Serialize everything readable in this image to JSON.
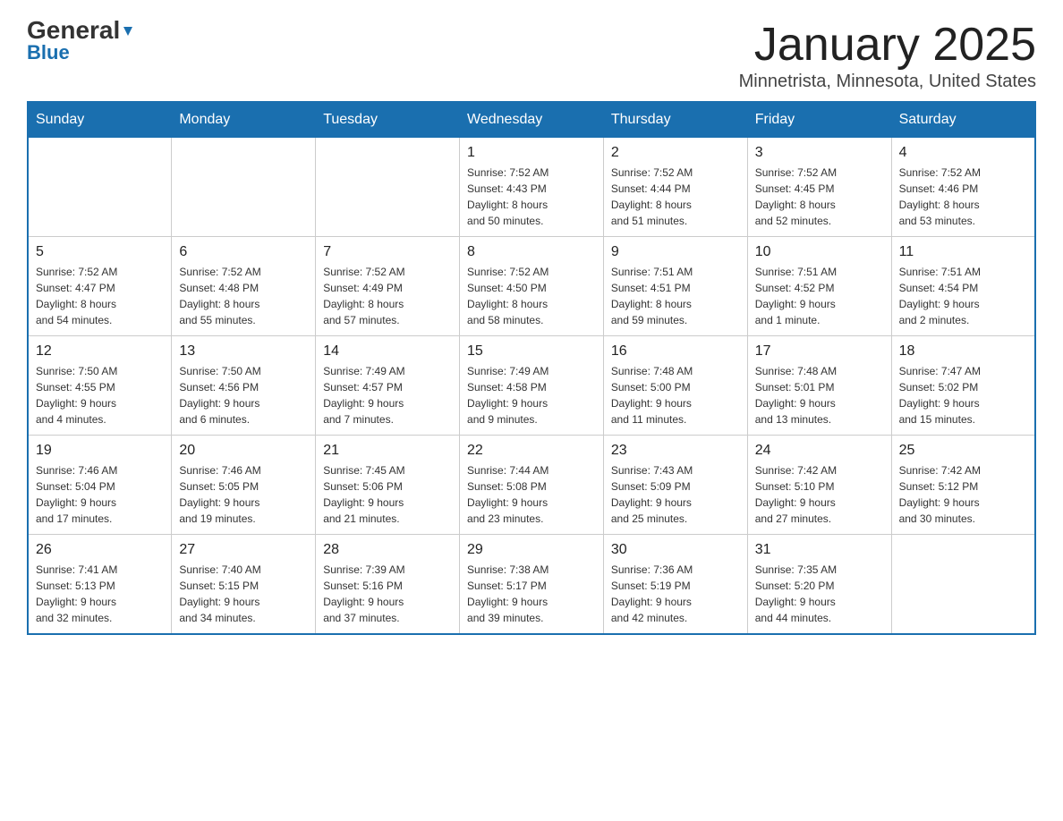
{
  "header": {
    "logo": {
      "general": "General",
      "blue": "Blue"
    },
    "title": "January 2025",
    "location": "Minnetrista, Minnesota, United States"
  },
  "weekdays": [
    "Sunday",
    "Monday",
    "Tuesday",
    "Wednesday",
    "Thursday",
    "Friday",
    "Saturday"
  ],
  "weeks": [
    [
      {
        "day": "",
        "info": ""
      },
      {
        "day": "",
        "info": ""
      },
      {
        "day": "",
        "info": ""
      },
      {
        "day": "1",
        "info": "Sunrise: 7:52 AM\nSunset: 4:43 PM\nDaylight: 8 hours\nand 50 minutes."
      },
      {
        "day": "2",
        "info": "Sunrise: 7:52 AM\nSunset: 4:44 PM\nDaylight: 8 hours\nand 51 minutes."
      },
      {
        "day": "3",
        "info": "Sunrise: 7:52 AM\nSunset: 4:45 PM\nDaylight: 8 hours\nand 52 minutes."
      },
      {
        "day": "4",
        "info": "Sunrise: 7:52 AM\nSunset: 4:46 PM\nDaylight: 8 hours\nand 53 minutes."
      }
    ],
    [
      {
        "day": "5",
        "info": "Sunrise: 7:52 AM\nSunset: 4:47 PM\nDaylight: 8 hours\nand 54 minutes."
      },
      {
        "day": "6",
        "info": "Sunrise: 7:52 AM\nSunset: 4:48 PM\nDaylight: 8 hours\nand 55 minutes."
      },
      {
        "day": "7",
        "info": "Sunrise: 7:52 AM\nSunset: 4:49 PM\nDaylight: 8 hours\nand 57 minutes."
      },
      {
        "day": "8",
        "info": "Sunrise: 7:52 AM\nSunset: 4:50 PM\nDaylight: 8 hours\nand 58 minutes."
      },
      {
        "day": "9",
        "info": "Sunrise: 7:51 AM\nSunset: 4:51 PM\nDaylight: 8 hours\nand 59 minutes."
      },
      {
        "day": "10",
        "info": "Sunrise: 7:51 AM\nSunset: 4:52 PM\nDaylight: 9 hours\nand 1 minute."
      },
      {
        "day": "11",
        "info": "Sunrise: 7:51 AM\nSunset: 4:54 PM\nDaylight: 9 hours\nand 2 minutes."
      }
    ],
    [
      {
        "day": "12",
        "info": "Sunrise: 7:50 AM\nSunset: 4:55 PM\nDaylight: 9 hours\nand 4 minutes."
      },
      {
        "day": "13",
        "info": "Sunrise: 7:50 AM\nSunset: 4:56 PM\nDaylight: 9 hours\nand 6 minutes."
      },
      {
        "day": "14",
        "info": "Sunrise: 7:49 AM\nSunset: 4:57 PM\nDaylight: 9 hours\nand 7 minutes."
      },
      {
        "day": "15",
        "info": "Sunrise: 7:49 AM\nSunset: 4:58 PM\nDaylight: 9 hours\nand 9 minutes."
      },
      {
        "day": "16",
        "info": "Sunrise: 7:48 AM\nSunset: 5:00 PM\nDaylight: 9 hours\nand 11 minutes."
      },
      {
        "day": "17",
        "info": "Sunrise: 7:48 AM\nSunset: 5:01 PM\nDaylight: 9 hours\nand 13 minutes."
      },
      {
        "day": "18",
        "info": "Sunrise: 7:47 AM\nSunset: 5:02 PM\nDaylight: 9 hours\nand 15 minutes."
      }
    ],
    [
      {
        "day": "19",
        "info": "Sunrise: 7:46 AM\nSunset: 5:04 PM\nDaylight: 9 hours\nand 17 minutes."
      },
      {
        "day": "20",
        "info": "Sunrise: 7:46 AM\nSunset: 5:05 PM\nDaylight: 9 hours\nand 19 minutes."
      },
      {
        "day": "21",
        "info": "Sunrise: 7:45 AM\nSunset: 5:06 PM\nDaylight: 9 hours\nand 21 minutes."
      },
      {
        "day": "22",
        "info": "Sunrise: 7:44 AM\nSunset: 5:08 PM\nDaylight: 9 hours\nand 23 minutes."
      },
      {
        "day": "23",
        "info": "Sunrise: 7:43 AM\nSunset: 5:09 PM\nDaylight: 9 hours\nand 25 minutes."
      },
      {
        "day": "24",
        "info": "Sunrise: 7:42 AM\nSunset: 5:10 PM\nDaylight: 9 hours\nand 27 minutes."
      },
      {
        "day": "25",
        "info": "Sunrise: 7:42 AM\nSunset: 5:12 PM\nDaylight: 9 hours\nand 30 minutes."
      }
    ],
    [
      {
        "day": "26",
        "info": "Sunrise: 7:41 AM\nSunset: 5:13 PM\nDaylight: 9 hours\nand 32 minutes."
      },
      {
        "day": "27",
        "info": "Sunrise: 7:40 AM\nSunset: 5:15 PM\nDaylight: 9 hours\nand 34 minutes."
      },
      {
        "day": "28",
        "info": "Sunrise: 7:39 AM\nSunset: 5:16 PM\nDaylight: 9 hours\nand 37 minutes."
      },
      {
        "day": "29",
        "info": "Sunrise: 7:38 AM\nSunset: 5:17 PM\nDaylight: 9 hours\nand 39 minutes."
      },
      {
        "day": "30",
        "info": "Sunrise: 7:36 AM\nSunset: 5:19 PM\nDaylight: 9 hours\nand 42 minutes."
      },
      {
        "day": "31",
        "info": "Sunrise: 7:35 AM\nSunset: 5:20 PM\nDaylight: 9 hours\nand 44 minutes."
      },
      {
        "day": "",
        "info": ""
      }
    ]
  ]
}
